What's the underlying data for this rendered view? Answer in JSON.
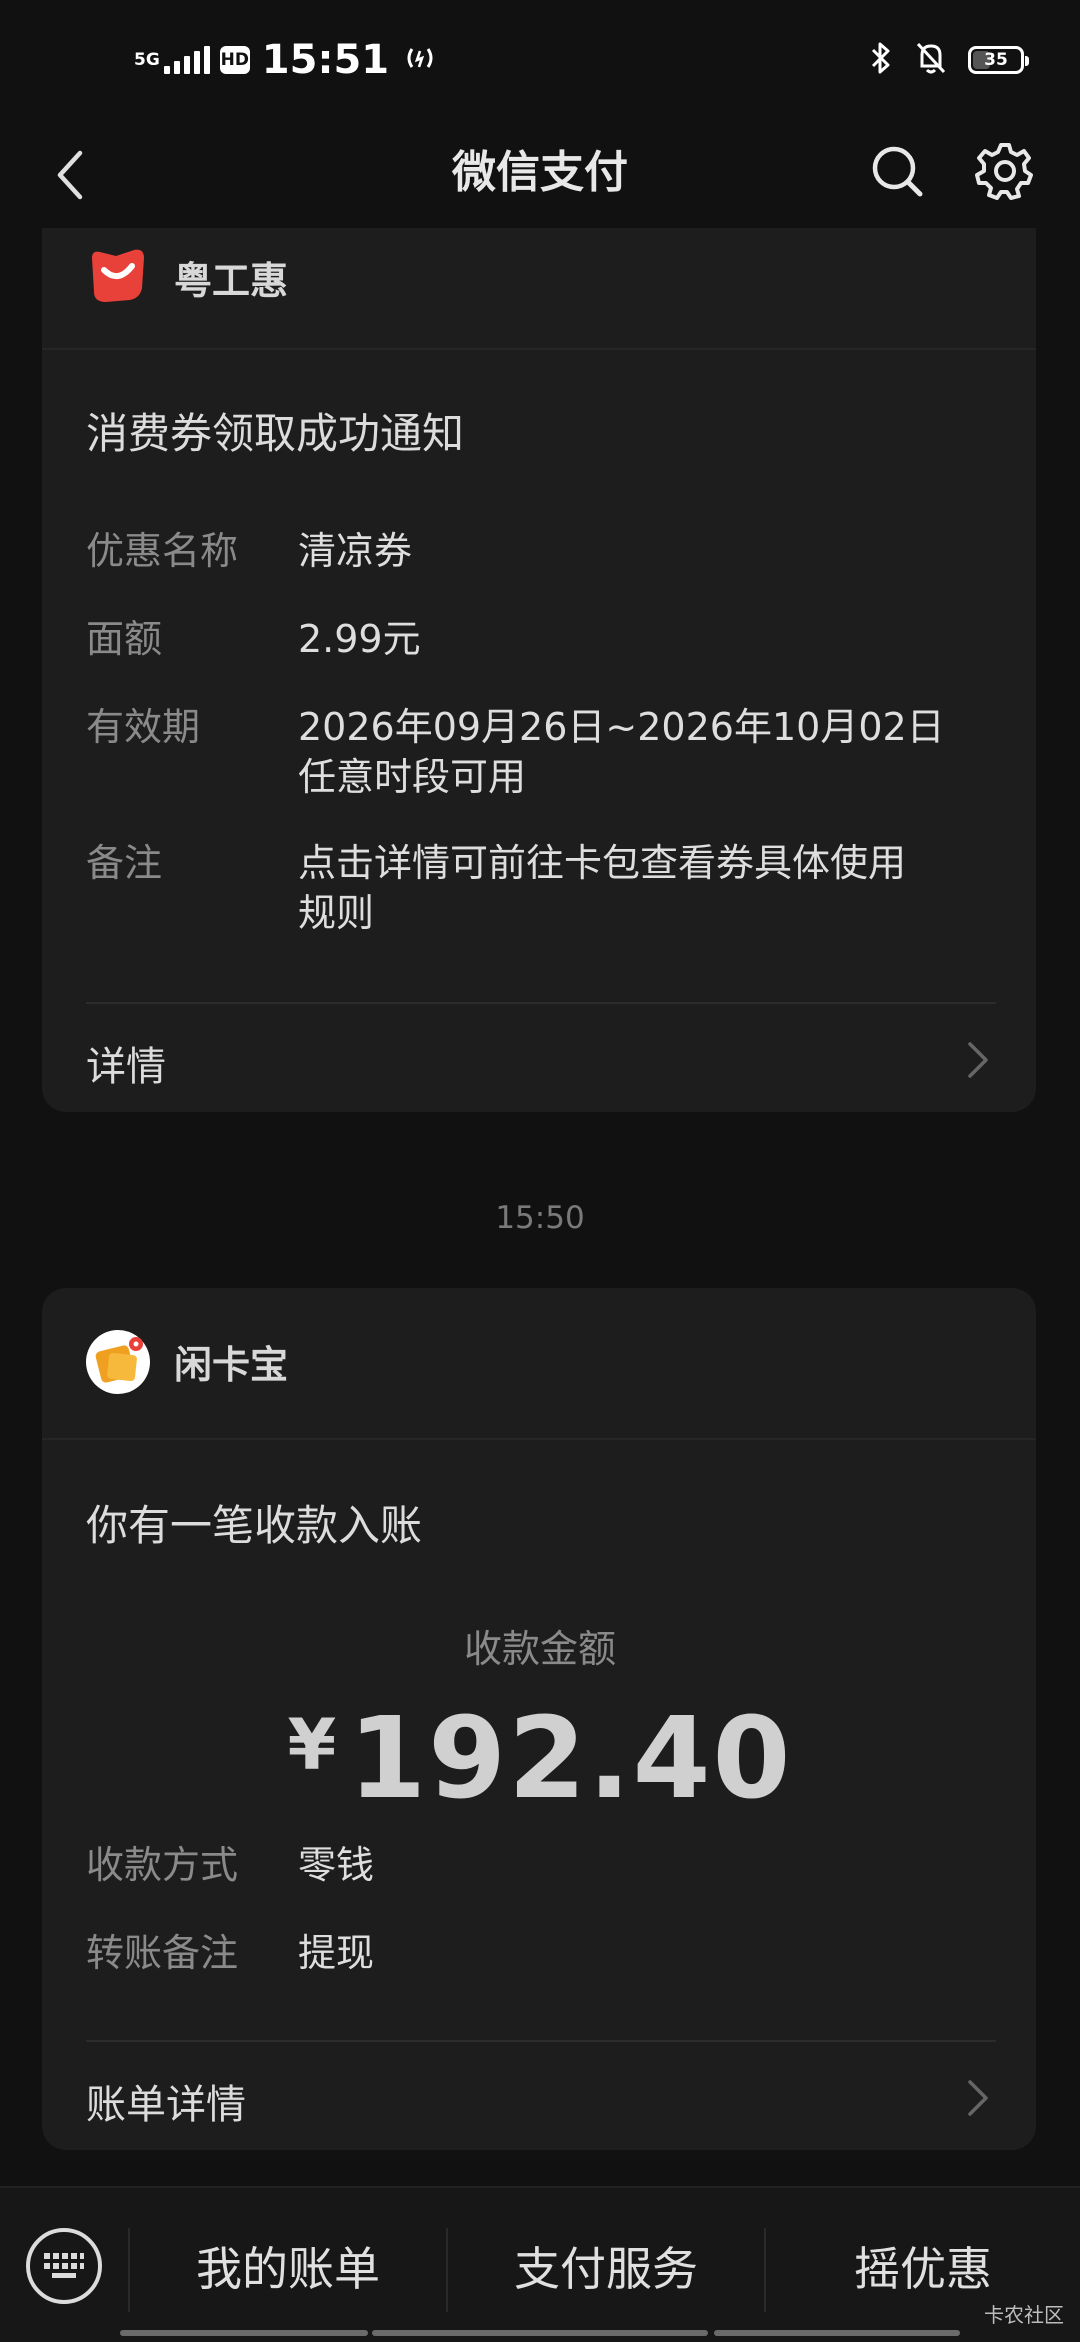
{
  "status_bar": {
    "network": "5G",
    "hd": "HD",
    "time": "15:51",
    "battery": "35"
  },
  "nav": {
    "title": "微信支付"
  },
  "card1": {
    "brand": "粤工惠",
    "title": "消费券领取成功通知",
    "rows": [
      {
        "label": "优惠名称",
        "value": "清凉券"
      },
      {
        "label": "面额",
        "value": "2.99元"
      },
      {
        "label": "有效期",
        "value": "2026年09月26日~2026年10月02日",
        "value2": "任意时段可用"
      },
      {
        "label": "备注",
        "value": "点击详情可前往卡包查看券具体使用",
        "value2": "规则"
      }
    ],
    "footer": "详情"
  },
  "timestamp": "15:50",
  "card2": {
    "brand": "闲卡宝",
    "title": "你有一笔收款入账",
    "amount_label": "收款金额",
    "currency": "¥",
    "amount": "192.40",
    "rows": [
      {
        "label": "收款方式",
        "value": "零钱"
      },
      {
        "label": "转账备注",
        "value": "提现"
      }
    ],
    "footer": "账单详情"
  },
  "bottom_menu": {
    "items": [
      "我的账单",
      "支付服务",
      "摇优惠"
    ]
  },
  "watermark": "卡农社区",
  "colors": {
    "background": "#111111",
    "card": "#1d1d1d",
    "brand_red": "#e8413a",
    "brand_orange": "#f0a020"
  }
}
